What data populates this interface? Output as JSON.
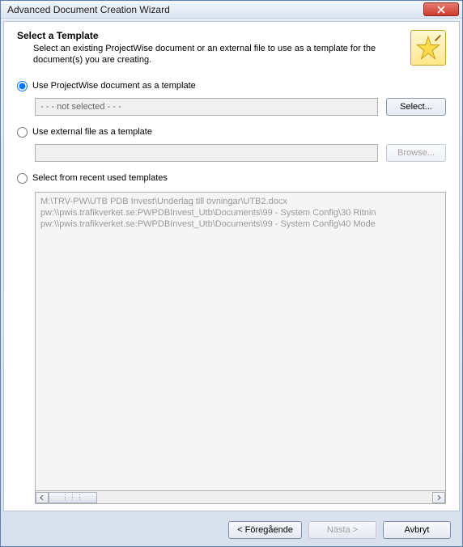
{
  "window": {
    "title": "Advanced Document Creation Wizard"
  },
  "header": {
    "title": "Select a Template",
    "description": "Select an existing ProjectWise document or an external file to use as a template for the document(s) you are creating."
  },
  "options": {
    "projectwise": {
      "label": "Use ProjectWise document as a template",
      "value": "- - - not selected - - -",
      "button": "Select..."
    },
    "external": {
      "label": "Use external file as a template",
      "value": "",
      "button": "Browse..."
    },
    "recent": {
      "label": "Select from recent used templates",
      "items": [
        "M:\\TRV-PW\\UTB PDB Invest\\Underlag till övningar\\UTB2.docx",
        "pw:\\\\pwis.trafikverket.se:PWPDBInvest_Utb\\Documents\\99 - System Config\\30 Ritnin",
        "pw:\\\\pwis.trafikverket.se:PWPDBInvest_Utb\\Documents\\99 - System Config\\40 Mode"
      ]
    }
  },
  "buttons": {
    "back": "< Föregående",
    "next": "Nästa >",
    "cancel": "Avbryt"
  }
}
